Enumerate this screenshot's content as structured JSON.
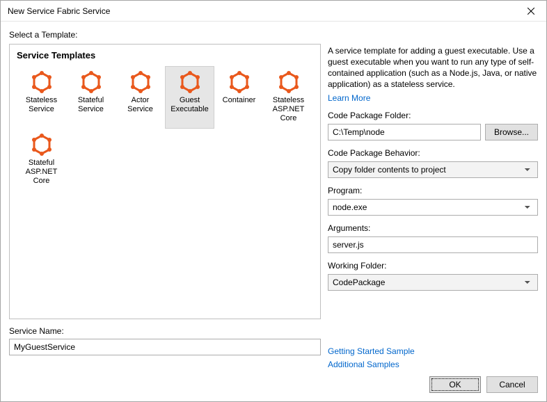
{
  "window": {
    "title": "New Service Fabric Service"
  },
  "prompt": "Select a Template:",
  "templatesTitle": "Service Templates",
  "templates": [
    {
      "label": "Stateless Service"
    },
    {
      "label": "Stateful Service"
    },
    {
      "label": "Actor Service"
    },
    {
      "label": "Guest Executable"
    },
    {
      "label": "Container"
    },
    {
      "label": "Stateless ASP.NET Core"
    },
    {
      "label": "Stateful ASP.NET Core"
    }
  ],
  "serviceName": {
    "label": "Service Name:",
    "value": "MyGuestService"
  },
  "right": {
    "description": "A service template for adding a guest executable. Use a guest executable when you want to run any type of self-contained application (such as a Node.js, Java, or native application) as a stateless service.",
    "learnMore": "Learn More",
    "codePackageFolder": {
      "label": "Code Package Folder:",
      "value": "C:\\Temp\\node",
      "browse": "Browse..."
    },
    "codePackageBehavior": {
      "label": "Code Package Behavior:",
      "value": "Copy folder contents to project"
    },
    "program": {
      "label": "Program:",
      "value": "node.exe"
    },
    "arguments": {
      "label": "Arguments:",
      "value": "server.js"
    },
    "workingFolder": {
      "label": "Working Folder:",
      "value": "CodePackage"
    },
    "links": {
      "gettingStarted": "Getting Started Sample",
      "additional": "Additional Samples"
    }
  },
  "buttons": {
    "ok": "OK",
    "cancel": "Cancel"
  }
}
